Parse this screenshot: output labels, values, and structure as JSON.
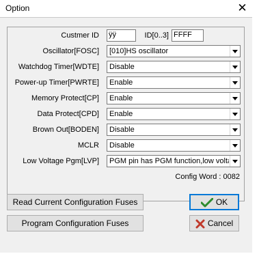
{
  "window": {
    "title": "Option",
    "close_glyph": "✕"
  },
  "fields": {
    "customer_id": {
      "label": "Custmer ID",
      "value": "ÿÿ"
    },
    "id_range": {
      "label": "ID[0..3]",
      "value": "FFFF"
    }
  },
  "rows": [
    {
      "label": "Oscillator[FOSC]",
      "value": "[010]HS oscillator"
    },
    {
      "label": "Watchdog Timer[WDTE]",
      "value": "Disable"
    },
    {
      "label": "Power-up Timer[PWRTE]",
      "value": "Enable"
    },
    {
      "label": "Memory Protect[CP]",
      "value": "Enable"
    },
    {
      "label": "Data Protect[CPD]",
      "value": "Enable"
    },
    {
      "label": "Brown Out[BODEN]",
      "value": "Disable"
    },
    {
      "label": "MCLR",
      "value": "Disable"
    },
    {
      "label": "Low Voltage Pgm[LVP]",
      "value": "PGM pin has PGM function,low voltage"
    }
  ],
  "config_word": "Config Word : 0082",
  "buttons": {
    "read": "Read Current Configuration Fuses",
    "program": "Program Configuration Fuses",
    "ok": "OK",
    "cancel": "Cancel"
  },
  "colors": {
    "ok_check": "#2e8b2e",
    "cancel_x": "#c0392b",
    "focus_border": "#0078d7"
  },
  "icons": {
    "ok": "check-icon",
    "cancel": "x-icon",
    "combo": "chevron-down-icon"
  }
}
